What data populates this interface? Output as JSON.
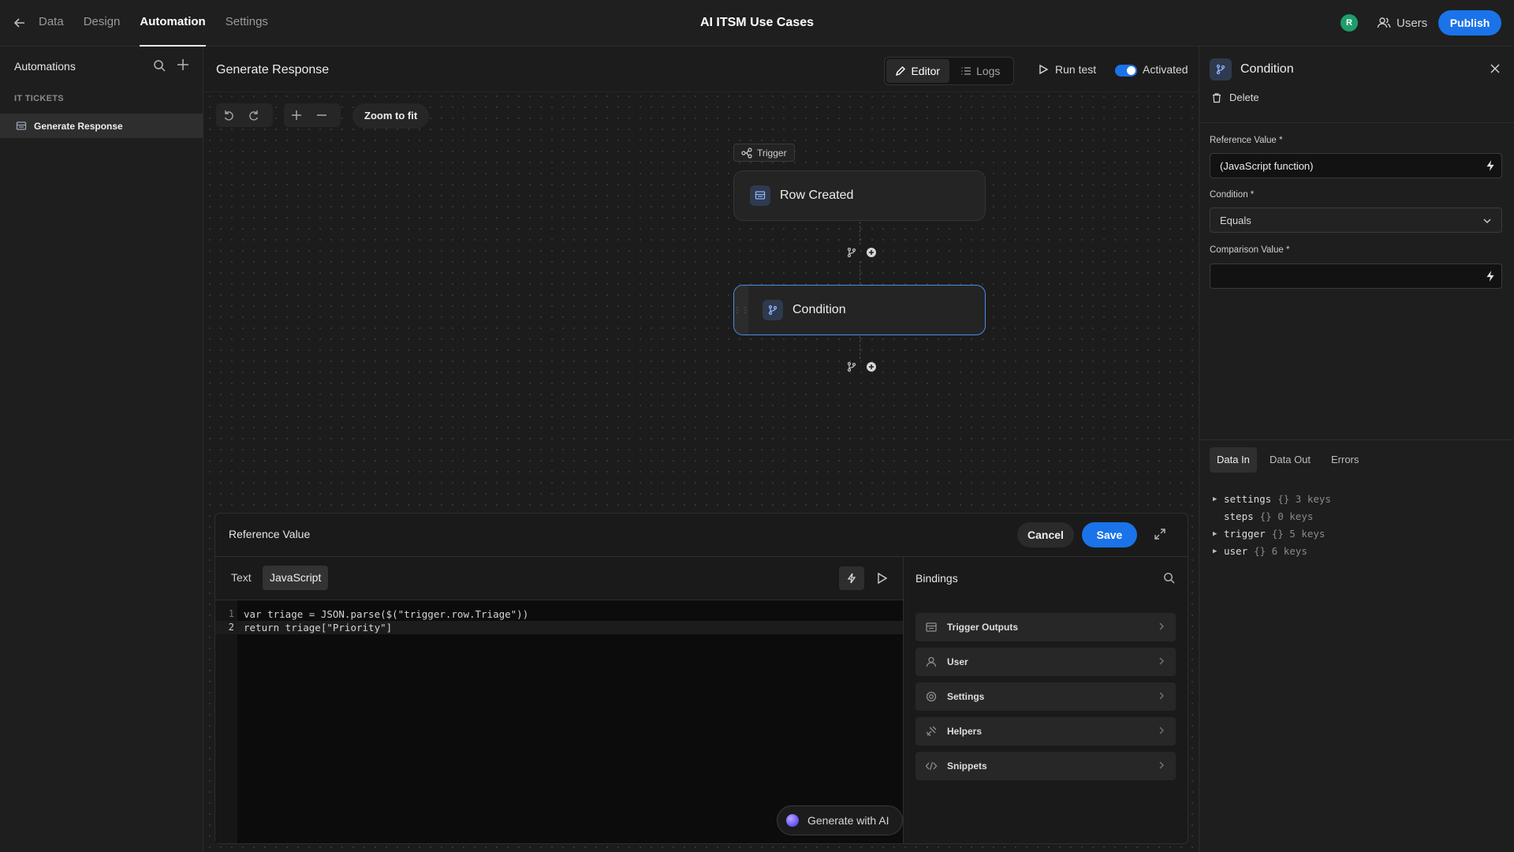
{
  "app": {
    "title": "AI ITSM Use Cases",
    "nav_tabs": [
      "Data",
      "Design",
      "Automation",
      "Settings"
    ],
    "active_tab": "Automation",
    "avatar_initial": "R",
    "users_label": "Users",
    "publish_label": "Publish"
  },
  "sidebar": {
    "title": "Automations",
    "section": "IT TICKETS",
    "items": [
      {
        "label": "Generate Response"
      }
    ]
  },
  "header": {
    "automation_name": "Generate Response",
    "editor_label": "Editor",
    "logs_label": "Logs",
    "run_test_label": "Run test",
    "activated_label": "Activated",
    "activated": true
  },
  "canvas": {
    "zoom_to_fit_label": "Zoom to fit",
    "trigger_tag": "Trigger",
    "nodes": [
      {
        "label": "Row Created"
      },
      {
        "label": "Condition"
      }
    ]
  },
  "code_panel": {
    "title": "Reference Value",
    "cancel_label": "Cancel",
    "save_label": "Save",
    "mode_text": "Text",
    "mode_js": "JavaScript",
    "active_mode": "JavaScript",
    "line_numbers": [
      "1",
      "2"
    ],
    "code_lines": [
      "var triage = JSON.parse($(\"trigger.row.Triage\"))",
      "return triage[\"Priority\"]"
    ],
    "generate_ai_label": "Generate with AI",
    "bindings_title": "Bindings",
    "bindings": [
      {
        "label": "Trigger Outputs",
        "icon": "table-icon"
      },
      {
        "label": "User",
        "icon": "user-icon"
      },
      {
        "label": "Settings",
        "icon": "gear-icon"
      },
      {
        "label": "Helpers",
        "icon": "helpers-icon"
      },
      {
        "label": "Snippets",
        "icon": "code-icon"
      }
    ]
  },
  "right_panel": {
    "title": "Condition",
    "delete_label": "Delete",
    "reference_value_label": "Reference Value *",
    "reference_value": "(JavaScript function)",
    "condition_label": "Condition *",
    "condition_value": "Equals",
    "comparison_value_label": "Comparison Value *",
    "comparison_value": "",
    "data_tabs": [
      "Data In",
      "Data Out",
      "Errors"
    ],
    "active_data_tab": "Data In",
    "tree": [
      {
        "key": "settings",
        "meta": "{} 3 keys",
        "expandable": true
      },
      {
        "key": "steps",
        "meta": "{} 0 keys",
        "expandable": false
      },
      {
        "key": "trigger",
        "meta": "{} 5 keys",
        "expandable": true
      },
      {
        "key": "user",
        "meta": "{} 6 keys",
        "expandable": true
      }
    ]
  },
  "colors": {
    "accent": "#1a73e8",
    "selected_node_border": "#4d8de8",
    "avatar": "#1f9d6b"
  }
}
